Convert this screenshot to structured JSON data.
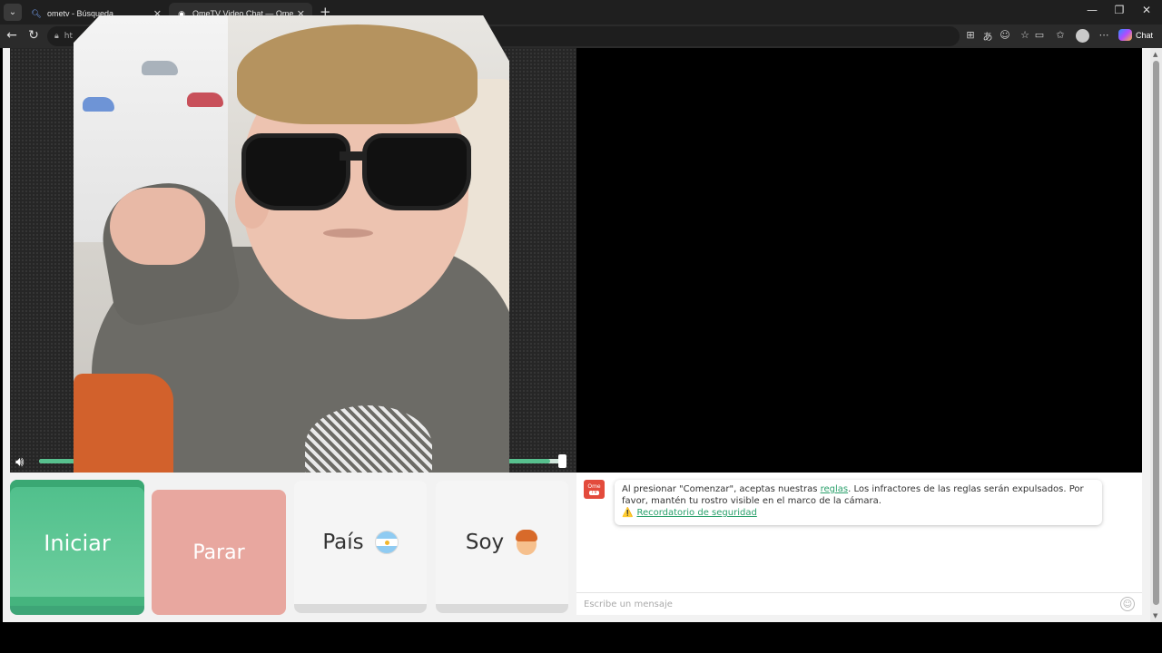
{
  "browser": {
    "tabs": [
      {
        "label": "ometv - Búsqueda",
        "icon": "search-icon"
      },
      {
        "label": "OmeTV Video Chat — Omegl",
        "icon": "camera-icon"
      }
    ],
    "url_prefix": "ht",
    "chat_label": "Chat"
  },
  "video": {
    "volume_level": 0.97
  },
  "controls": {
    "start_label": "Iniciar",
    "stop_label": "Parar",
    "country_label": "País",
    "gender_label": "Soy"
  },
  "chat": {
    "logo_top": "Ome",
    "logo_bottom": "TV",
    "notice_pre": "Al presionar \"Comenzar\", aceptas nuestras ",
    "notice_link": "reglas",
    "notice_post": ". Los infractores de las reglas serán expulsados. Por favor, mantén tu rostro visible en el marco de la cámara.",
    "safety_link": "Recordatorio de seguridad",
    "input_placeholder": "Escribe un mensaje"
  },
  "colors": {
    "start": "#57c08e",
    "stop": "#e8a79f",
    "accent_link": "#2aa06b"
  }
}
